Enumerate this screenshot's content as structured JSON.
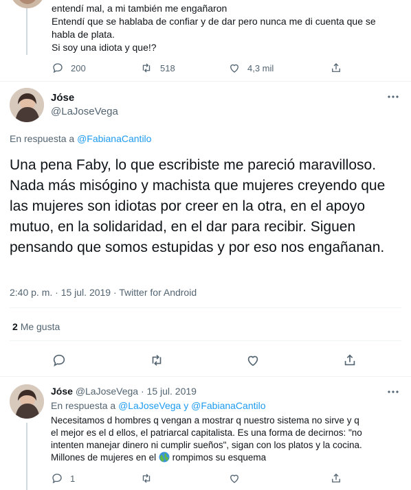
{
  "top_tweet": {
    "lines": [
      "entendí mal, a mi también me engañaron",
      "Entendí que se hablaba de confiar y de dar pero nunca me di cuenta que se",
      "habla de plata.",
      "Si soy una idiota y que!?"
    ],
    "replies": "200",
    "retweets": "518",
    "likes": "4,3 mil"
  },
  "main_tweet": {
    "display_name": "Jóse",
    "handle": "@LaJoseVega",
    "reply_prefix": "En respuesta a",
    "reply_to": "@FabianaCantilo",
    "text": "Una pena Faby, lo que escribiste me pareció maravilloso. Nada más misógino y machista que mujeres creyendo que las mujeres son idiotas por creer en la otra, en el apoyo mutuo, en la solidaridad, en el dar para recibir. Siguen pensando que somos estupidas y por eso nos engañanan.",
    "timestamp": "2:40 p. m. · 15 jul. 2019 · Twitter for Android",
    "like_count": "2",
    "like_label": "Me gusta",
    "more_icon": "more-icon"
  },
  "reply_tweet": {
    "display_name": "Jóse",
    "handle": "@LaJoseVega",
    "sep": "·",
    "date": "15 jul. 2019",
    "reply_prefix": "En respuesta a",
    "reply_to_1": "@LaJoseVega",
    "reply_and": "y",
    "reply_to_2": "@FabianaCantilo",
    "lines": [
      "Necesitamos d hombres q vengan a mostrar q nuestro sistema no sirve y q",
      "el mejor es el d ellos, el patriarcal capitalista. Es una forma de decirnos: \"no",
      "intenten manejar dinero ni cumplir sueños\", sigan  con los platos y la cocina."
    ],
    "line4_before": "Millones de mujeres en el",
    "line4_after": "rompimos su esquema",
    "replies": "1"
  },
  "colors": {
    "accent": "#1d9bf0",
    "muted": "#536471",
    "text": "#0f1419",
    "border": "#eff3f4"
  }
}
